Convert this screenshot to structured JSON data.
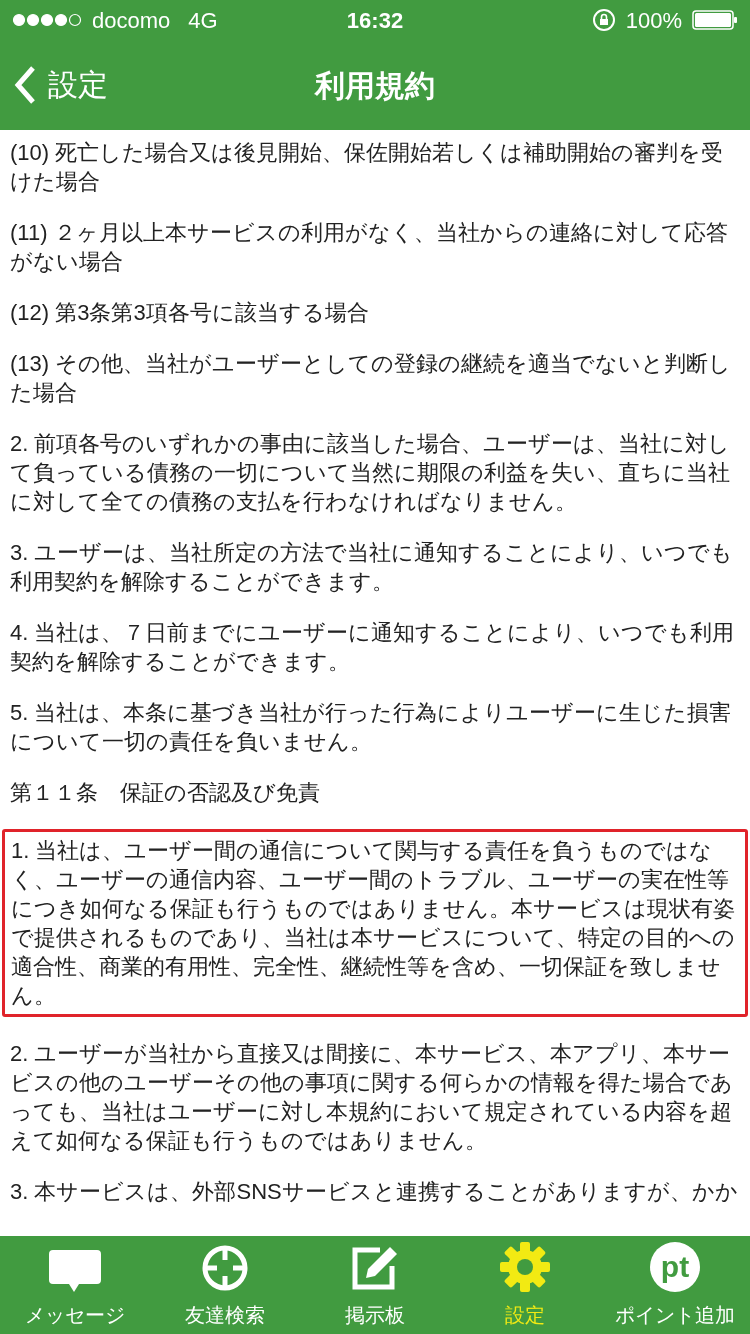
{
  "status_bar": {
    "carrier": "docomo",
    "network": "4G",
    "time": "16:32",
    "battery": "100%"
  },
  "nav_bar": {
    "back_label": "設定",
    "title": "利用規約"
  },
  "paragraphs": [
    {
      "text": "(10) 死亡した場合又は後見開始、保佐開始若しくは補助開始の審判を受けた場合",
      "highlighted": false
    },
    {
      "text": "(11) ２ヶ月以上本サービスの利用がなく、当社からの連絡に対して応答がない場合",
      "highlighted": false
    },
    {
      "text": "(12) 第3条第3項各号に該当する場合",
      "highlighted": false
    },
    {
      "text": "(13) その他、当社がユーザーとしての登録の継続を適当でないと判断した場合",
      "highlighted": false
    },
    {
      "text": "2. 前項各号のいずれかの事由に該当した場合、ユーザーは、当社に対して負っている債務の一切について当然に期限の利益を失い、直ちに当社に対して全ての債務の支払を行わなければなりません。",
      "highlighted": false
    },
    {
      "text": "3. ユーザーは、当社所定の方法で当社に通知することにより、いつでも利用契約を解除することができます。",
      "highlighted": false
    },
    {
      "text": "4. 当社は、７日前までにユーザーに通知することにより、いつでも利用契約を解除することができます。",
      "highlighted": false
    },
    {
      "text": "5. 当社は、本条に基づき当社が行った行為によりユーザーに生じた損害について一切の責任を負いません。",
      "highlighted": false
    },
    {
      "text": "第１１条　保証の否認及び免責",
      "highlighted": false
    },
    {
      "text": "1. 当社は、ユーザー間の通信について関与する責任を負うものではなく、ユーザーの通信内容、ユーザー間のトラブル、ユーザーの実在性等につき如何なる保証も行うものではありません。本サービスは現状有姿で提供されるものであり、当社は本サービスについて、特定の目的への適合性、商業的有用性、完全性、継続性等を含め、一切保証を致しません。",
      "highlighted": true
    },
    {
      "text": "2. ユーザーが当社から直接又は間接に、本サービス、本アプリ、本サービスの他のユーザーその他の事項に関する何らかの情報を得た場合であっても、当社はユーザーに対し本規約において規定されている内容を超えて如何なる保証も行うものではありません。",
      "highlighted": false
    },
    {
      "text": "3. 本サービスは、外部SNSサービスと連携することがありますが、かか",
      "highlighted": false
    }
  ],
  "tab_bar": [
    {
      "label": "メッセージ",
      "selected": false
    },
    {
      "label": "友達検索",
      "selected": false
    },
    {
      "label": "掲示板",
      "selected": false
    },
    {
      "label": "設定",
      "selected": true
    },
    {
      "label": "ポイント追加",
      "icon_text": "pt",
      "selected": false
    }
  ]
}
